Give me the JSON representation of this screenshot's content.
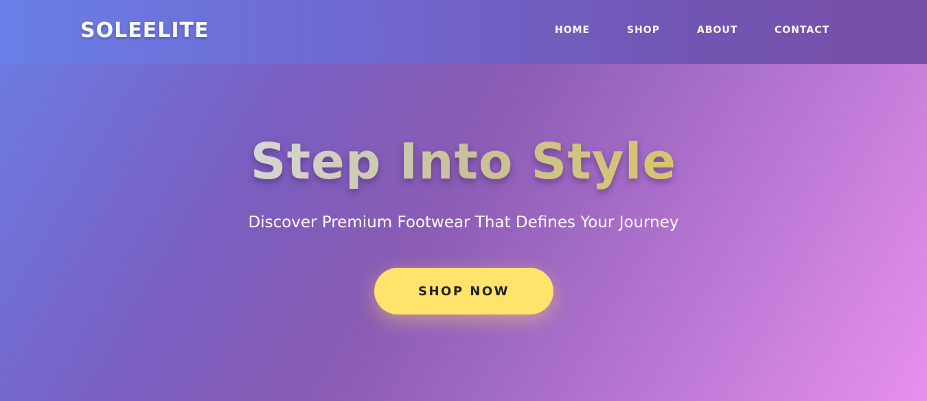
{
  "header": {
    "logo": "SOLEELITE",
    "nav": [
      {
        "label": "HOME"
      },
      {
        "label": "SHOP"
      },
      {
        "label": "ABOUT"
      },
      {
        "label": "CONTACT"
      }
    ]
  },
  "hero": {
    "title": "Step Into Style",
    "subtitle": "Discover Premium Footwear That Defines Your Journey",
    "cta_label": "SHOP NOW"
  },
  "colors": {
    "accent": "#ffe36a",
    "header_bg": "#6f68d0",
    "gradient_start": "#6b7ee6",
    "gradient_end": "#e890ee"
  }
}
